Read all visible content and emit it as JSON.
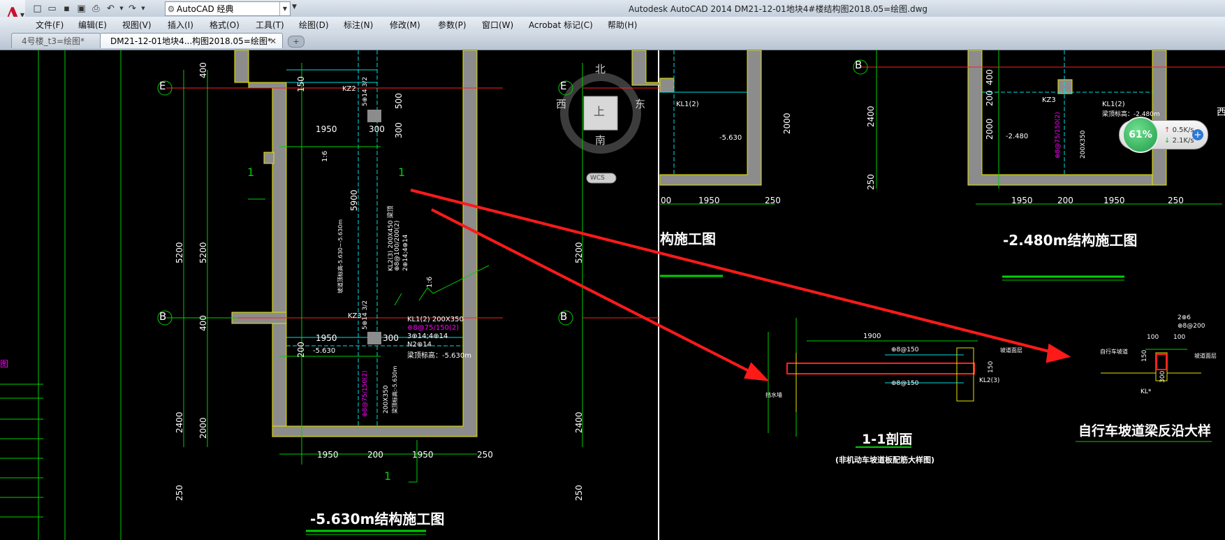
{
  "app": {
    "title": "Autodesk AutoCAD 2014    DM21-12-01地块4#楼结构图2018.05=绘图.dwg",
    "logo": "A",
    "workspace": "AutoCAD 经典"
  },
  "menu": [
    "文件(F)",
    "编辑(E)",
    "视图(V)",
    "插入(I)",
    "格式(O)",
    "工具(T)",
    "绘图(D)",
    "标注(N)",
    "修改(M)",
    "参数(P)",
    "窗口(W)",
    "Acrobat 标记(C)",
    "帮助(H)"
  ],
  "tabs": [
    {
      "label": "4号楼_t3=绘图*"
    },
    {
      "label": "DM21-12-01地块4...构图2018.05=绘图*"
    }
  ],
  "viewcube": {
    "north": "北",
    "south": "南",
    "east": "东",
    "west": "西",
    "top": "上",
    "wcs": "WCS"
  },
  "net_speed": {
    "percent": "61%",
    "up": "0.5K/s",
    "down": "2.1K/s"
  },
  "drawing": {
    "title_left": "-5.630m结构施工图",
    "title_mid_partial": "构施工图",
    "title_right": "-2.480m结构施工图",
    "section_title": "1-1剖面",
    "section_subtitle": "(非机动车坡道板配筋大样图)",
    "detail_title": "自行车坡道梁反沿大样",
    "axis_e": "E",
    "axis_b": "B",
    "section_1": "1",
    "side_text": "图",
    "east_partial": "西",
    "dims_left": {
      "d5200a": "5200",
      "d5200b": "5200",
      "d2400": "2400",
      "d2000": "2000",
      "d250": "250",
      "d400a": "400",
      "d400b": "400",
      "d150": "150",
      "d500": "500",
      "d300a": "300",
      "d5900": "5900",
      "d200": "200"
    },
    "dims_bottom": [
      "1950",
      "200",
      "1950",
      "250"
    ],
    "dims_1950a": "1950",
    "dims_300": "300",
    "left_labels": {
      "kz2": "KZ2",
      "kz3": "KZ3",
      "kl1": "KL1(2) 200X350",
      "kl1b": "⊕8@75/150(2)",
      "kl1c": "3⊕14;4⊕14",
      "kl1d": "N2⊕14",
      "kl1e": "梁顶标高：-5.630m",
      "lev": "-5.630",
      "slope": "1:6",
      "kl2": "KL2(3) 200X450 梁顶",
      "kl2b": "⊕8@100/200(2)",
      "kl2c": "2⊕14;4⊕14",
      "col": "5⊕14 3/2",
      "dim200x350": "200X350",
      "ramp_note": "坡道顶标高-5.630~-5.630m",
      "beam_note": "梁顶标高:-5.630m"
    },
    "mid_labels": {
      "kl1": "KL1(2)",
      "lev": "-5.630",
      "d1950": "1950",
      "d250": "250",
      "d2000": "2000",
      "d00": "00"
    },
    "right_labels": {
      "kz3": "KZ3",
      "kl1": "KL1(2)",
      "kl1b": "梁顶标高：-2.480m",
      "lev": "-2.480",
      "d2400": "2400",
      "d2000": "2000",
      "d400": "400",
      "d200": "200",
      "d250": "250",
      "d1950a": "1950",
      "d200b": "200",
      "d1950b": "1950",
      "d250b": "250",
      "pink": "⊕8@75/150(2)",
      "dim200x350": "200X350"
    },
    "section_labels": {
      "d1900": "1900",
      "r1": "⊕8@150",
      "r2": "⊕8@150",
      "kl2": "KL2(3)",
      "d150": "150",
      "left": "挡水墙",
      "right": "坡道面层"
    },
    "detail_labels": {
      "a": "2⊕6",
      "b": "⊕8@200",
      "c": "100",
      "d": "100",
      "e": "150",
      "f": "300",
      "g": "KL*",
      "left": "自行车坡道",
      "right": "坡道面层"
    }
  }
}
